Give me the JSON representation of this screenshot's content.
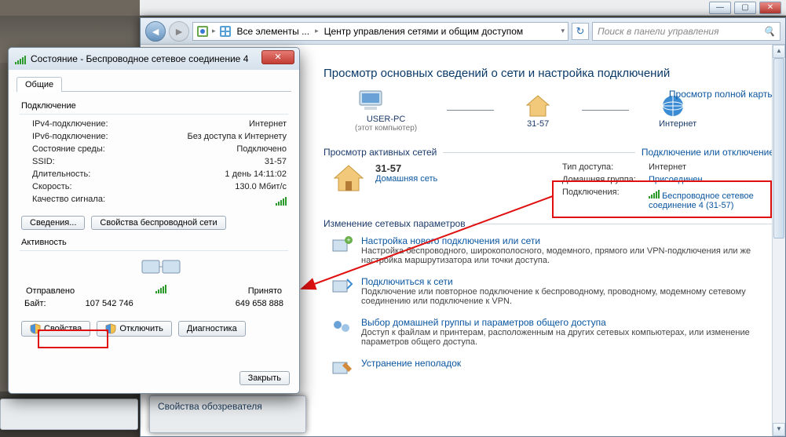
{
  "window_controls": {
    "min": "—",
    "max": "▢",
    "close": "✕"
  },
  "nav": {
    "breadcrumb": [
      "Все элементы ...",
      "Центр управления сетями и общим доступом"
    ],
    "back_arrow": "◄",
    "fwd_arrow": "►",
    "chev": "▸",
    "drop": "▾",
    "refresh": "↻",
    "search_placeholder": "Поиск в панели управления",
    "search_icon": "🔍"
  },
  "page": {
    "title": "Просмотр основных сведений о сети и настройка подключений",
    "fullmap_link": "Просмотр полной карты",
    "map": {
      "node1": "USER-PC",
      "node1_sub": "(этот компьютер)",
      "node2": "31-57",
      "node3": "Интернет"
    },
    "active_hdr": "Просмотр активных сетей",
    "connect_link": "Подключение или отключение",
    "net": {
      "name": "31-57",
      "kind": "Домашняя сеть"
    },
    "props": {
      "access_k": "Тип доступа:",
      "access_v": "Интернет",
      "home_k": "Домашняя группа:",
      "home_v": "Присоединен",
      "conn_k": "Подключения:",
      "conn_v": "Беспроводное сетевое соединение 4 (31-57)"
    },
    "change_hdr": "Изменение сетевых параметров",
    "items": [
      {
        "title": "Настройка нового подключения или сети",
        "desc": "Настройка беспроводного, широкополосного, модемного, прямого или VPN-подключения или же настройка маршрутизатора или точки доступа."
      },
      {
        "title": "Подключиться к сети",
        "desc": "Подключение или повторное подключение к беспроводному, проводному, модемному сетевому соединению или подключение к VPN."
      },
      {
        "title": "Выбор домашней группы и параметров общего доступа",
        "desc": "Доступ к файлам и принтерам, расположенным на других сетевых компьютерах, или изменение параметров общего доступа."
      },
      {
        "title": "Устранение неполадок",
        "desc": ""
      }
    ]
  },
  "sidebarfrag": "Свойства обозревателя",
  "status": {
    "title": "Состояние - Беспроводное сетевое соединение 4",
    "tab": "Общие",
    "conn_hdr": "Подключение",
    "rows": {
      "ipv4_k": "IPv4-подключение:",
      "ipv4_v": "Интернет",
      "ipv6_k": "IPv6-подключение:",
      "ipv6_v": "Без доступа к Интернету",
      "media_k": "Состояние среды:",
      "media_v": "Подключено",
      "ssid_k": "SSID:",
      "ssid_v": "31-57",
      "dur_k": "Длительность:",
      "dur_v": "1 день 14:11:02",
      "speed_k": "Скорость:",
      "speed_v": "130.0 Мбит/с",
      "qual_k": "Качество сигнала:"
    },
    "btn_details": "Сведения...",
    "btn_wprops": "Свойства беспроводной сети",
    "activity_hdr": "Активность",
    "sent_lbl": "Отправлено",
    "recv_lbl": "Принято",
    "bytes_k": "Байт:",
    "bytes_sent": "107 542 746",
    "bytes_recv": "649 658 888",
    "btn_props": "Свойства",
    "btn_disable": "Отключить",
    "btn_diag": "Диагностика",
    "btn_close": "Закрыть",
    "close_x": "✕"
  }
}
